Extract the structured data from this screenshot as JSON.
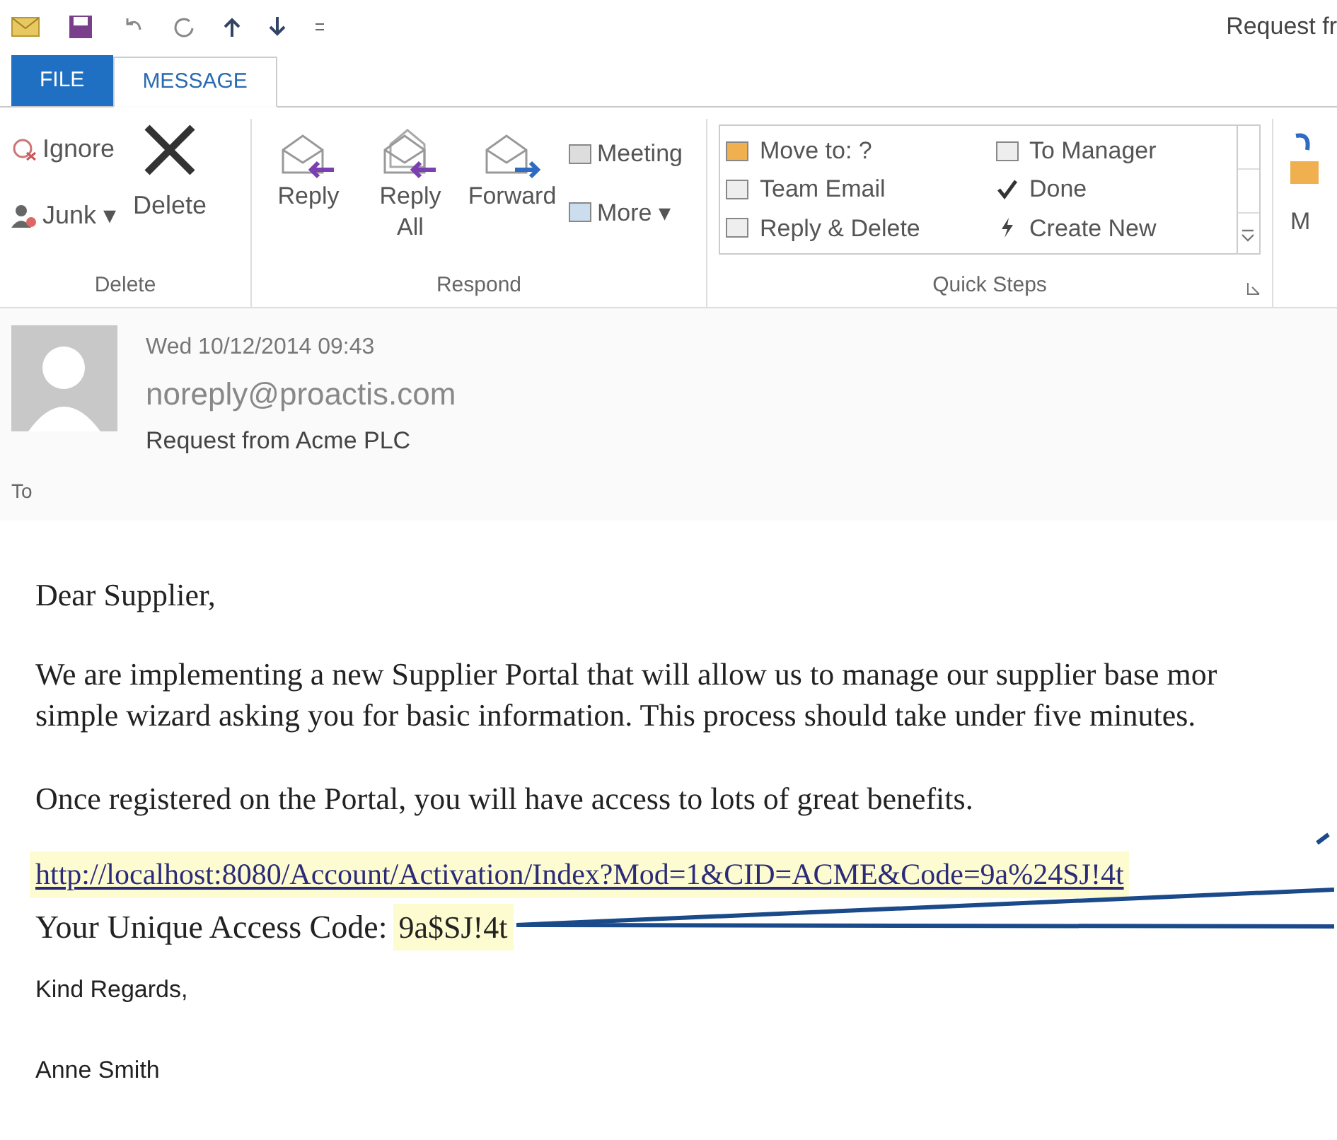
{
  "window": {
    "title": "Request fr"
  },
  "tabs": [
    {
      "label": "FILE",
      "selected": false,
      "kind": "file"
    },
    {
      "label": "MESSAGE",
      "selected": true,
      "kind": "normal"
    }
  ],
  "ribbon": {
    "groups": [
      {
        "label": "Delete",
        "kind": "delete",
        "items": [
          {
            "label": "Ignore"
          },
          {
            "label": "Junk ▾"
          },
          {
            "label": "Delete"
          }
        ]
      },
      {
        "label": "Respond",
        "kind": "respond",
        "items": [
          {
            "label": "Reply"
          },
          {
            "label": "Reply All"
          },
          {
            "label": "Forward"
          },
          {
            "label": "Meeting"
          },
          {
            "label": "More ▾"
          }
        ]
      },
      {
        "label": "Quick Steps",
        "kind": "quicksteps",
        "items": [
          {
            "label": "Move to: ?"
          },
          {
            "label": "Team Email"
          },
          {
            "label": "Reply & Delete"
          },
          {
            "label": "To Manager"
          },
          {
            "label": "Done"
          },
          {
            "label": "Create New"
          }
        ]
      },
      {
        "label": "M",
        "kind": "move"
      }
    ]
  },
  "message": {
    "date": "Wed 10/12/2014 09:43",
    "sender": "noreply@proactis.com",
    "subject": "Request from Acme PLC",
    "to_label": "To"
  },
  "body": {
    "greeting": "Dear Supplier,",
    "paragraph": "We are implementing a new Supplier Portal that will allow us to manage our supplier base mor",
    "paragraph_2": "simple wizard asking you for basic information. This process should take under five minutes.",
    "benefits": "Once registered on the Portal, you will have access to lots of great benefits.",
    "link": "http://localhost:8080/Account/Activation/Index?Mod=1&CID=ACME&Code=9a%24SJ!4t",
    "code_label": "Your Unique Access Code:",
    "code": "9a$SJ!4t",
    "closing": "Kind Regards,",
    "signature": "Anne Smith"
  }
}
